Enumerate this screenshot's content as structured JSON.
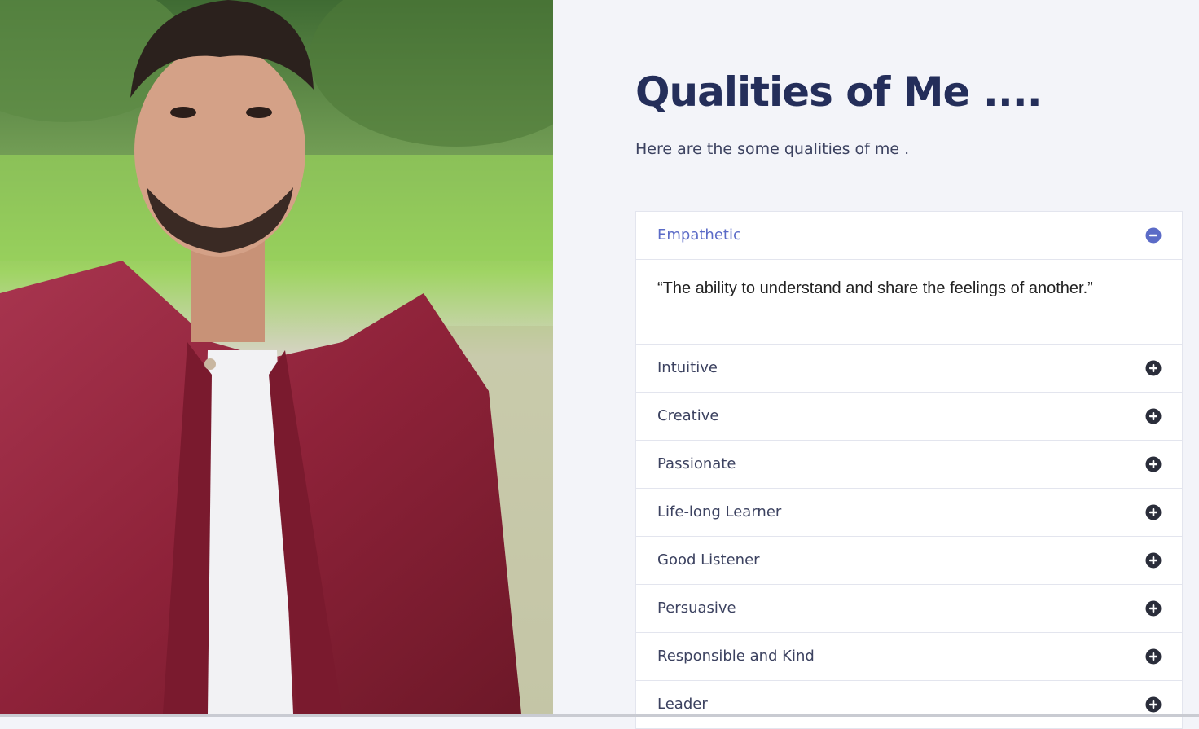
{
  "title": "Qualities of Me ....",
  "subtitle": "Here are the some qualities of me .",
  "accordion": {
    "items": [
      {
        "label": "Empathetic",
        "open": true,
        "text": "“The ability to understand and share the feelings of another.”"
      },
      {
        "label": "Intuitive",
        "open": false
      },
      {
        "label": "Creative",
        "open": false
      },
      {
        "label": "Passionate",
        "open": false
      },
      {
        "label": "Life-long Learner",
        "open": false
      },
      {
        "label": "Good Listener",
        "open": false
      },
      {
        "label": "Persuasive",
        "open": false
      },
      {
        "label": "Responsible and Kind",
        "open": false
      },
      {
        "label": "Leader",
        "open": false
      }
    ]
  },
  "icons": {
    "open": "minus-circle-icon",
    "closed": "plus-circle-icon"
  },
  "colors": {
    "title": "#242e5a",
    "active": "#5b6bc7",
    "icon": "#2a2d3a",
    "background": "#f3f4f9"
  }
}
